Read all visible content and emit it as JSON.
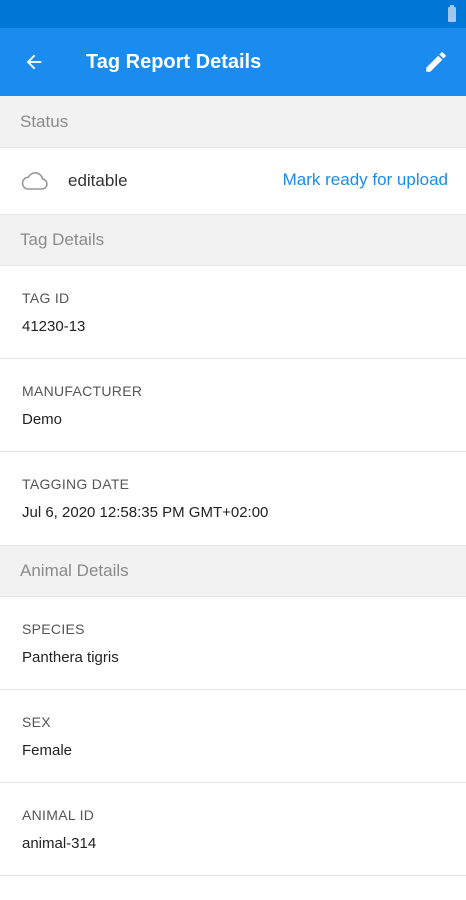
{
  "app": {
    "title": "Tag Report Details",
    "accent_color": "#1a8cf0",
    "icons": {
      "back": "arrow-left-icon",
      "edit": "pencil-icon",
      "status": "cloud-icon",
      "battery": "battery-icon"
    }
  },
  "status_section": {
    "header": "Status",
    "status_value": "editable",
    "action_label": "Mark ready for upload"
  },
  "tag_details": {
    "header": "Tag Details",
    "fields": [
      {
        "label": "TAG ID",
        "value": "41230-13"
      },
      {
        "label": "MANUFACTURER",
        "value": "Demo"
      },
      {
        "label": "TAGGING DATE",
        "value": "Jul 6, 2020 12:58:35 PM GMT+02:00"
      }
    ]
  },
  "animal_details": {
    "header": "Animal Details",
    "fields": [
      {
        "label": "SPECIES",
        "value": "Panthera tigris"
      },
      {
        "label": "SEX",
        "value": "Female"
      },
      {
        "label": "ANIMAL ID",
        "value": "animal-314"
      }
    ]
  }
}
